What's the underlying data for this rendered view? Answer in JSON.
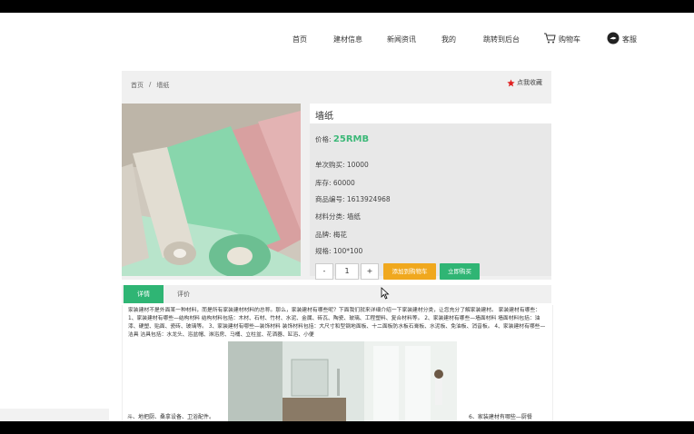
{
  "nav": {
    "home": "首页",
    "materials": "建材信息",
    "news": "新闻资讯",
    "mine": "我的",
    "admin": "跳转到后台",
    "cart": "购物车",
    "service": "客服"
  },
  "breadcrumb": {
    "home": "首页",
    "sep": "/",
    "current": "墙纸"
  },
  "favorite": "点我收藏",
  "product": {
    "name": "墙纸",
    "price_label": "价格:",
    "price": "25RMB",
    "single_limit": "单次购买: 10000",
    "stock": "库存: 60000",
    "code": "商品编号: 1613924968",
    "category": "材料分类: 墙纸",
    "brand": "品牌: 梅花",
    "spec": "规格: 100*100",
    "qty": "1",
    "minus": "-",
    "plus": "+",
    "add_cart": "添加到购物车",
    "buy_now": "立即购买"
  },
  "tabs": {
    "detail": "详情",
    "review": "评价"
  },
  "description": "家装建材不是外面某一种材料，而是所有家装建材材料的总称。那么，家装建材有哪些呢？下面我们就来详细介绍一下家装建材分类，让您充分了解家装建材。 家装建材有哪些： 1、家装建材有哪些—结构材料 结构材料包括：木材、石材、竹材、水泥、金属、砖瓦、陶瓷、玻璃、工程塑料、复合材料等。 2、家装建材有哪些—墙面材料 墙面材料包括：油漆、硬塑、贴面、瓷砖、玻璃等。 3、家装建材有哪些—装饰材料 装饰材料包括：大尺寸和型钢地面板、十二面板防水板石膏板、水泥板、免油板、消音板。 4、家装建材有哪些—洁具 洁具包括：水龙头、浴盆帽、淋浴房、马桶、立柱盆、花洒器、缸浴、小便",
  "bottom_left": "斗、地把厨、桑拿设备、卫浴配件。",
  "bottom_right": "6、家装建材有哪些—厨餐",
  "colors": {
    "accent_green": "#2fb574",
    "accent_orange": "#f0a81e",
    "star_red": "#e02020"
  }
}
